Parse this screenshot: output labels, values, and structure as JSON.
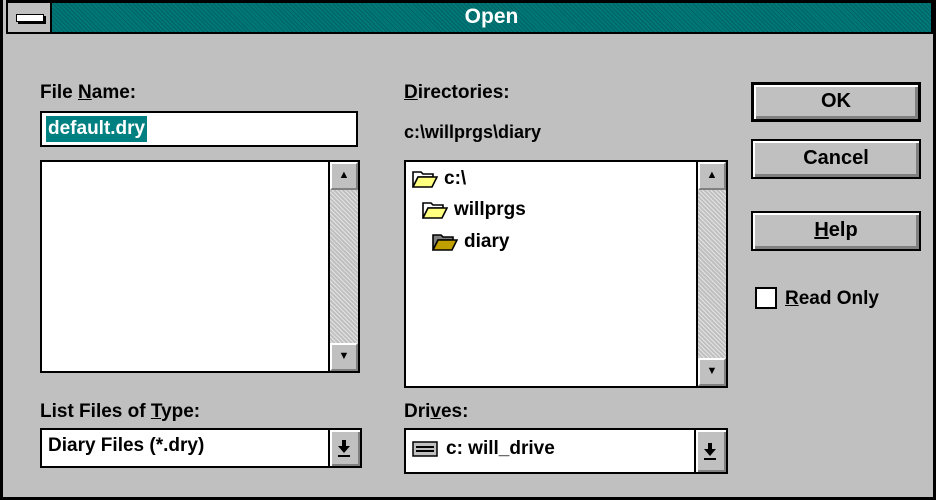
{
  "window": {
    "title": "Open"
  },
  "file_name": {
    "label_pre": "File ",
    "label_key": "N",
    "label_post": "ame:",
    "value": "default.dry",
    "files": []
  },
  "directories": {
    "label_key": "D",
    "label_post": "irectories:",
    "current_path": "c:\\willprgs\\diary",
    "items": [
      {
        "name": "c:\\",
        "icon": "open-folder-icon"
      },
      {
        "name": "willprgs",
        "icon": "open-folder-icon"
      },
      {
        "name": "diary",
        "icon": "open-folder-selected-icon"
      }
    ]
  },
  "buttons": {
    "ok": "OK",
    "cancel": "Cancel",
    "help_key": "H",
    "help_post": "elp"
  },
  "read_only": {
    "label_key": "R",
    "label_post": "ead Only",
    "checked": false
  },
  "list_type": {
    "label_pre": "List Files of ",
    "label_key": "T",
    "label_post": "ype:",
    "selected": "Diary Files (*.dry)"
  },
  "drives": {
    "label_pre": "Dri",
    "label_key": "v",
    "label_post": "es:",
    "selected": "c: will_drive",
    "icon": "drive-icon"
  },
  "colors": {
    "title_bar": "#007878",
    "selection": "#008080",
    "dialog_bg": "#c0c0c0"
  }
}
